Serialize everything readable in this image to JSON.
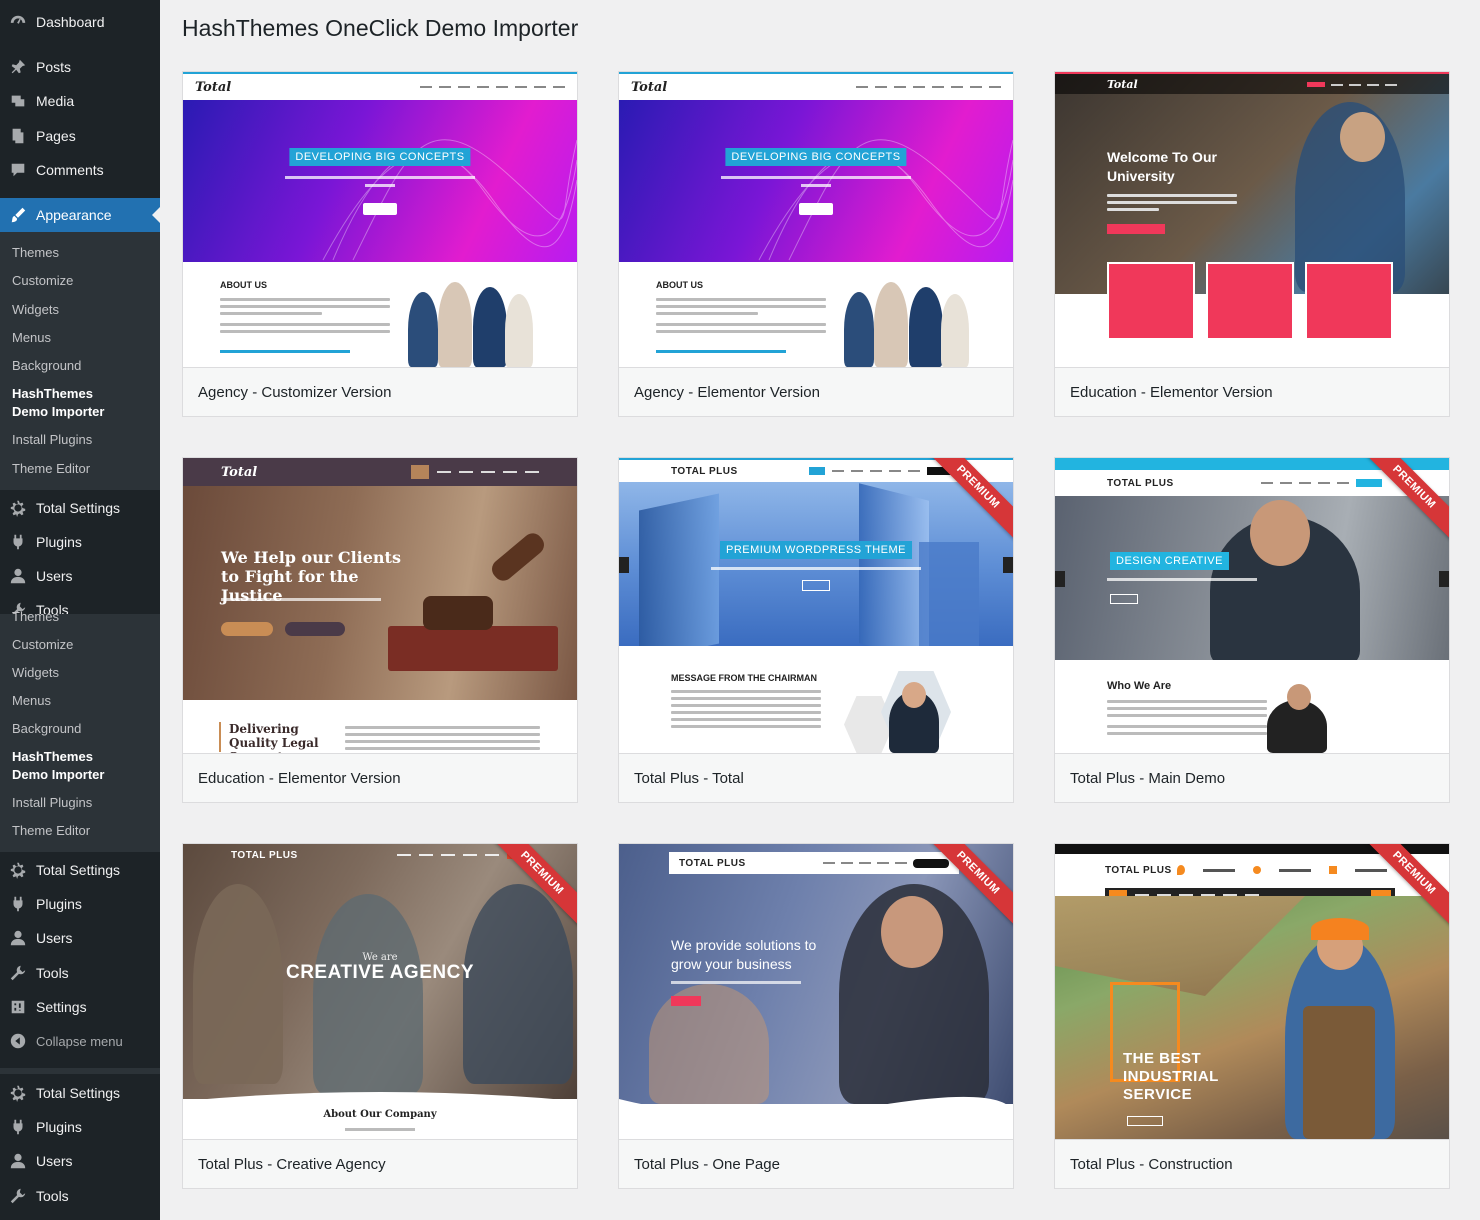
{
  "sidebar": {
    "top_items": [
      {
        "label": "Dashboard",
        "icon": "dashboard-icon"
      },
      {
        "label": "Posts",
        "icon": "pin-icon"
      },
      {
        "label": "Media",
        "icon": "media-icon"
      },
      {
        "label": "Pages",
        "icon": "pages-icon"
      },
      {
        "label": "Comments",
        "icon": "comment-icon"
      },
      {
        "label": "Appearance",
        "icon": "paintbrush-icon"
      }
    ],
    "appearance_submenu": [
      "Themes",
      "Customize",
      "Widgets",
      "Menus",
      "Background",
      "HashThemes Demo Importer",
      "Install Plugins",
      "Theme Editor"
    ],
    "group1": [
      {
        "label": "Total Settings",
        "icon": "gear-icon"
      },
      {
        "label": "Plugins",
        "icon": "plugin-icon"
      },
      {
        "label": "Users",
        "icon": "user-icon"
      },
      {
        "label": "Tools",
        "icon": "wrench-icon"
      }
    ],
    "submenu2": [
      "Themes",
      "Customize",
      "Widgets",
      "Menus",
      "Background",
      "HashThemes Demo Importer",
      "Install Plugins",
      "Theme Editor"
    ],
    "group2": [
      {
        "label": "Total Settings",
        "icon": "gear-icon"
      },
      {
        "label": "Plugins",
        "icon": "plugin-icon"
      },
      {
        "label": "Users",
        "icon": "user-icon"
      },
      {
        "label": "Tools",
        "icon": "wrench-icon"
      },
      {
        "label": "Settings",
        "icon": "settings-icon"
      },
      {
        "label": "Collapse menu",
        "icon": "collapse-icon"
      }
    ],
    "group3": [
      {
        "label": "Total Settings",
        "icon": "gear-icon"
      },
      {
        "label": "Plugins",
        "icon": "plugin-icon"
      },
      {
        "label": "Users",
        "icon": "user-icon"
      },
      {
        "label": "Tools",
        "icon": "wrench-icon"
      }
    ]
  },
  "page": {
    "title": "HashThemes OneClick Demo Importer"
  },
  "demos": [
    {
      "name": "Agency - Customizer Version",
      "premium": false
    },
    {
      "name": "Agency - Elementor Version",
      "premium": false
    },
    {
      "name": "Education - Elementor Version",
      "premium": false
    },
    {
      "name": "Education - Elementor Version",
      "premium": false
    },
    {
      "name": "Total Plus - Total",
      "premium": true
    },
    {
      "name": "Total Plus - Main Demo",
      "premium": true
    },
    {
      "name": "Total Plus - Creative Agency",
      "premium": true
    },
    {
      "name": "Total Plus - One Page",
      "premium": true
    },
    {
      "name": "Total Plus - Construction",
      "premium": true
    }
  ],
  "premium_label": "PREMIUM",
  "thumb_text": {
    "logo_total": "Total",
    "logo_plus": "TOTAL PLUS",
    "agency_tag": "DEVELOPING BIG CONCEPTS",
    "agency_about": "ABOUT US",
    "edu_welcome": "Welcome To Our University",
    "law_title": "We Help our Clients to Fight for the Justice",
    "law_bottom": "Delivering Quality Legal Support",
    "tp_tag": "PREMIUM WORDPRESS THEME",
    "tp_chairman": "MESSAGE FROM THE CHAIRMAN",
    "main_tag": "DESIGN CREATIVE",
    "main_who": "Who We Are",
    "creative_we_are": "We are",
    "creative_title": "CREATIVE AGENCY",
    "creative_about": "About Our Company",
    "onepage_title": "We provide solutions to grow your business",
    "construct_title": "THE BEST INDUSTRIAL SERVICE"
  },
  "colors": {
    "sidebar_bg": "#1d2327",
    "submenu_bg": "#2c3338",
    "accent": "#2271b1",
    "premium": "#d63638"
  }
}
